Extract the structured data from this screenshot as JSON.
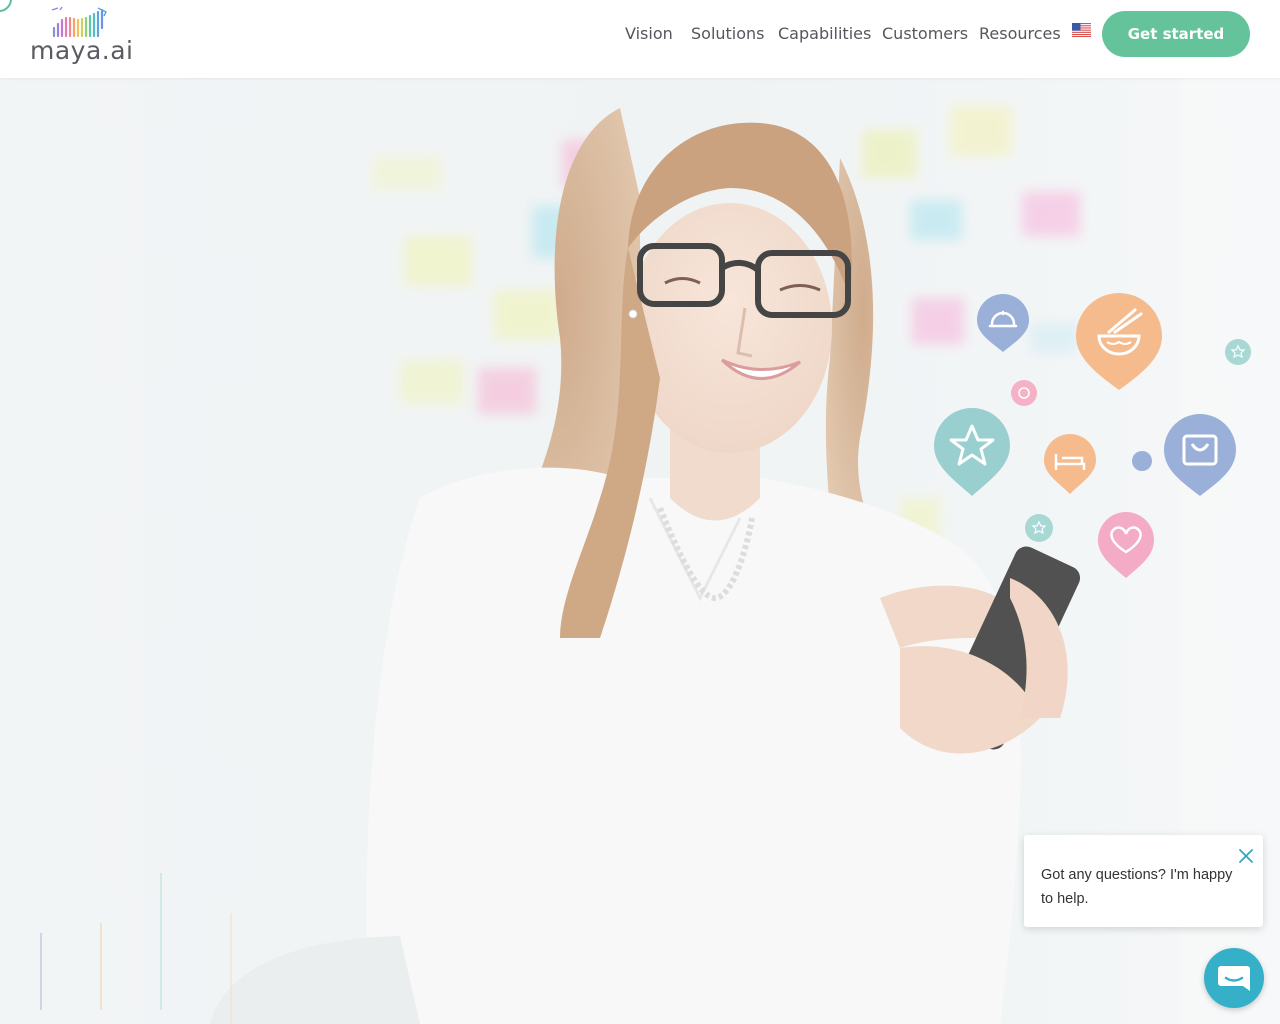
{
  "header": {
    "logo_text": "maya.ai",
    "nav": [
      {
        "label": "Vision"
      },
      {
        "label": "Solutions"
      },
      {
        "label": "Capabilities"
      },
      {
        "label": "Customers"
      },
      {
        "label": "Resources"
      }
    ],
    "language_flag_icon": "us-flag-icon",
    "cta_label": "Get started"
  },
  "hero": {
    "image": "woman-with-glasses-using-smartphone",
    "floating_icons": [
      "cloche-icon",
      "noodle-bowl-icon",
      "star-icon",
      "bed-icon",
      "shopping-bag-icon",
      "heart-icon"
    ]
  },
  "chat": {
    "message": "Got any questions? I'm happy to help.",
    "close_icon": "close-icon",
    "launcher_icon": "chat-icon"
  },
  "colors": {
    "brand_green": "#65c39b",
    "chat_blue": "#35b0c8",
    "nav_text": "#56565e"
  }
}
